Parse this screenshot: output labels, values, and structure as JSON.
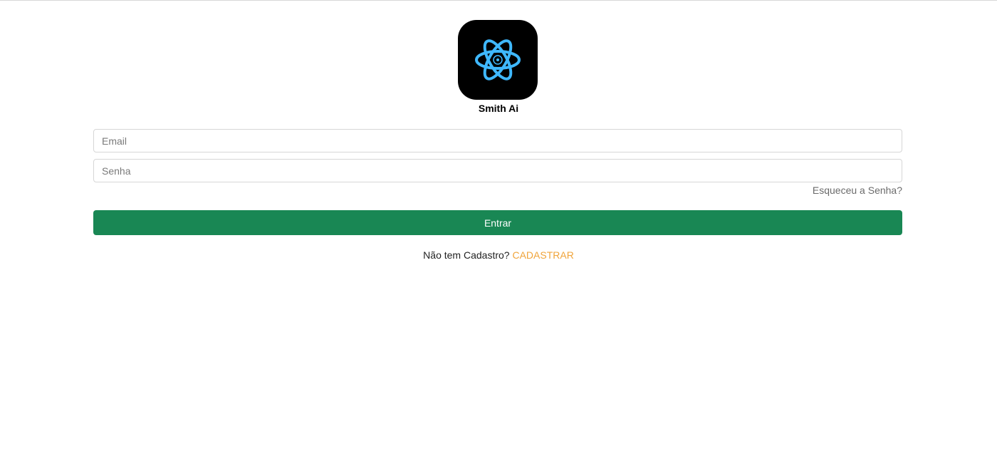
{
  "app": {
    "name": "Smith Ai",
    "logo_icon": "atom-icon"
  },
  "form": {
    "email_placeholder": "Email",
    "email_value": "",
    "password_placeholder": "Senha",
    "password_value": "",
    "forgot_label": "Esqueceu a Senha?",
    "submit_label": "Entrar"
  },
  "signup": {
    "prompt": "Não tem Cadastro?",
    "link_label": "CADASTRAR"
  },
  "colors": {
    "primary_button": "#198754",
    "signup_link": "#f0a43a",
    "logo_background": "#000000",
    "logo_orbit": "#3fb8ff"
  }
}
